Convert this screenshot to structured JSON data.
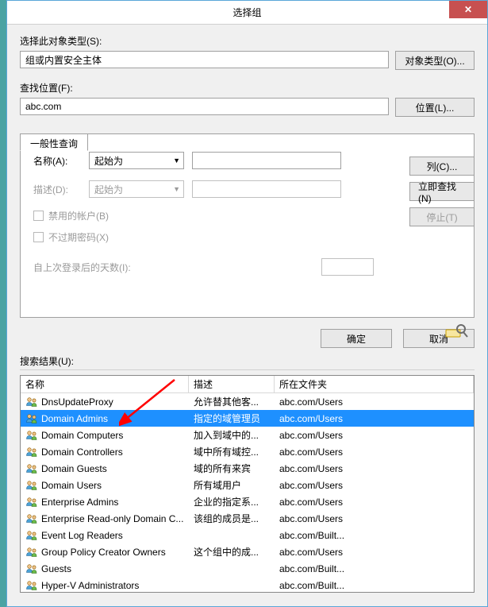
{
  "window": {
    "title": "选择组"
  },
  "objectType": {
    "label": "选择此对象类型(S):",
    "value": "组或内置安全主体",
    "button": "对象类型(O)..."
  },
  "location": {
    "label": "查找位置(F):",
    "value": "abc.com",
    "button": "位置(L)..."
  },
  "tabs": {
    "general": "一般性查询"
  },
  "form": {
    "name": {
      "label": "名称(A):",
      "combo": "起始为"
    },
    "desc": {
      "label": "描述(D):",
      "combo": "起始为"
    },
    "chk_disabled": "禁用的帐户(B)",
    "chk_noexpire": "不过期密码(X)",
    "days_label": "自上次登录后的天数(I):"
  },
  "side": {
    "columns": "列(C)...",
    "findnow": "立即查找(N)",
    "stop": "停止(T)"
  },
  "buttons": {
    "ok": "确定",
    "cancel": "取消"
  },
  "results": {
    "label": "搜索结果(U):",
    "columns": {
      "name": "名称",
      "desc": "描述",
      "loc": "所在文件夹"
    },
    "selectedIndex": 1,
    "rows": [
      {
        "name": "DnsUpdateProxy",
        "desc": "允许替其他客...",
        "loc": "abc.com/Users"
      },
      {
        "name": "Domain Admins",
        "desc": "指定的域管理员",
        "loc": "abc.com/Users"
      },
      {
        "name": "Domain Computers",
        "desc": "加入到域中的...",
        "loc": "abc.com/Users"
      },
      {
        "name": "Domain Controllers",
        "desc": "域中所有域控...",
        "loc": "abc.com/Users"
      },
      {
        "name": "Domain Guests",
        "desc": "域的所有来宾",
        "loc": "abc.com/Users"
      },
      {
        "name": "Domain Users",
        "desc": "所有域用户",
        "loc": "abc.com/Users"
      },
      {
        "name": "Enterprise Admins",
        "desc": "企业的指定系...",
        "loc": "abc.com/Users"
      },
      {
        "name": "Enterprise Read-only Domain C...",
        "desc": "该组的成员是...",
        "loc": "abc.com/Users"
      },
      {
        "name": "Event Log Readers",
        "desc": "",
        "loc": "abc.com/Built..."
      },
      {
        "name": "Group Policy Creator Owners",
        "desc": "这个组中的成...",
        "loc": "abc.com/Users"
      },
      {
        "name": "Guests",
        "desc": "",
        "loc": "abc.com/Built..."
      },
      {
        "name": "Hyper-V Administrators",
        "desc": "",
        "loc": "abc.com/Built..."
      }
    ]
  }
}
